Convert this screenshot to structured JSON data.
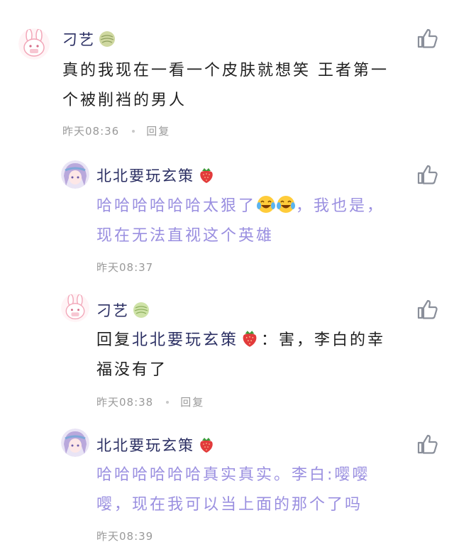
{
  "comments": [
    {
      "user": "刁艺",
      "text_lines": [
        "真的我现在一看一个皮肤就想笑 王者第一",
        "个被削裆的男人"
      ],
      "time": "昨天08:36",
      "reply_label": "回复"
    },
    {
      "user": "北北要玩玄策",
      "text_line1_prefix": "哈哈哈哈哈哈太狠了",
      "text_line1_suffix": "，我也是，",
      "text_line2": "现在无法直视这个英雄",
      "time": "昨天08:37"
    },
    {
      "user": "刁艺",
      "reply_prefix": "回复",
      "reply_target": "北北要玩玄策",
      "reply_line1_suffix": "：害，李白的幸",
      "reply_line2": "福没有了",
      "time": "昨天08:38",
      "reply_label": "回复"
    },
    {
      "user": "北北要玩玄策",
      "text_lines": [
        "哈哈哈哈哈哈真实真实。李白:嘤嘤",
        "嘤，现在我可以当上面的那个了吗"
      ],
      "time": "昨天08:39"
    }
  ],
  "icons": {
    "like": "thumbs-up-outline-icon",
    "melon": "melon-icon",
    "strawberry": "strawberry-icon",
    "laugh": "laughing-crying-emoji"
  },
  "colors": {
    "name": "#2b2f63",
    "reply_text": "#9a8fe0",
    "meta": "#9a9a9a",
    "like_icon": "#8a8f9a"
  }
}
